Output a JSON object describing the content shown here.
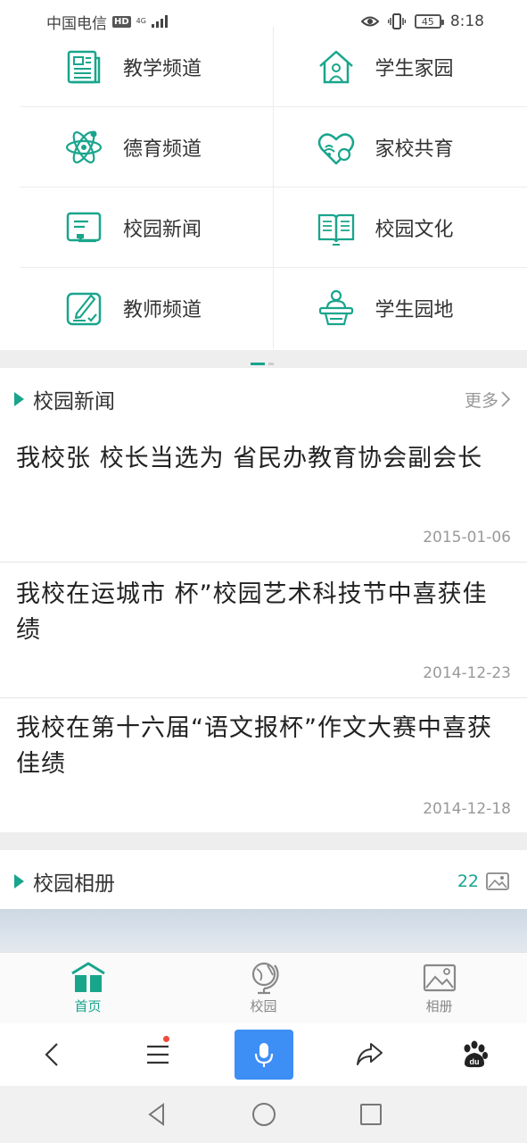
{
  "status_bar": {
    "carrier": "中国电信",
    "hd": "HD",
    "network": "4G",
    "battery": "45",
    "time": "8:18"
  },
  "grid": [
    [
      {
        "label": "教学频道",
        "icon": "document-icon"
      },
      {
        "label": "学生家园",
        "icon": "home-icon"
      }
    ],
    [
      {
        "label": "德育频道",
        "icon": "atom-icon"
      },
      {
        "label": "家校共育",
        "icon": "heart-wifi-icon"
      }
    ],
    [
      {
        "label": "校园新闻",
        "icon": "news-board-icon"
      },
      {
        "label": "校园文化",
        "icon": "book-icon"
      }
    ],
    [
      {
        "label": "教师频道",
        "icon": "edit-doc-icon"
      },
      {
        "label": "学生园地",
        "icon": "podium-icon"
      }
    ]
  ],
  "news_section": {
    "title": "校园新闻",
    "more": "更多",
    "items": [
      {
        "title": "我校张 校长当选为 省民办教育协会副会长",
        "date": "2015-01-06"
      },
      {
        "title": "我校在运城市 杯”校园艺术科技节中喜获佳绩",
        "date": "2014-12-23"
      },
      {
        "title": "我校在第十六届“语文报杯”作文大赛中喜获佳绩",
        "date": "2014-12-18"
      }
    ]
  },
  "album_section": {
    "title": "校园相册",
    "count": "22"
  },
  "tabs": [
    {
      "label": "首页",
      "icon": "book-home-icon",
      "active": true
    },
    {
      "label": "校园",
      "icon": "globe-icon",
      "active": false
    },
    {
      "label": "相册",
      "icon": "image-icon",
      "active": false
    }
  ],
  "colors": {
    "accent": "#19a58c",
    "mic": "#3d8ef5"
  }
}
